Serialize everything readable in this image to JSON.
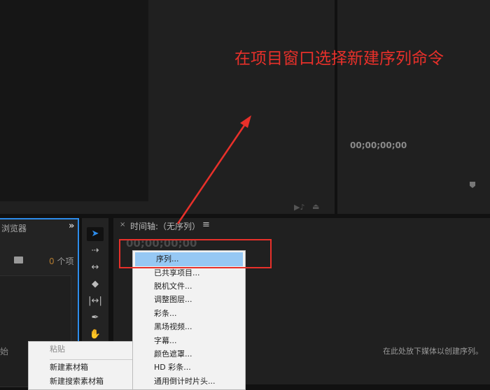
{
  "annotation": "在项目窗口选择新建序列命令",
  "program_monitor": {
    "timecode": "00;00;00;00"
  },
  "project_panel": {
    "title": "浏览器",
    "more": "»",
    "item_count_num": "0",
    "item_count_unit": " 个项",
    "cut_text": "始"
  },
  "tools": [
    "select",
    "track-select",
    "ripple-edit",
    "razor",
    "slip",
    "pen",
    "hand"
  ],
  "timeline": {
    "close": "×",
    "title": "时间轴:（无序列）",
    "menu": "≡",
    "timecode": "00;00;00;00",
    "drop_hint": "在此处放下媒体以创建序列。"
  },
  "context_menu": {
    "items": [
      {
        "label": "粘贴",
        "disabled": true
      },
      {
        "label": "新建素材箱"
      },
      {
        "label": "新建搜索素材箱"
      }
    ]
  },
  "new_item_submenu": {
    "items": [
      "序列...",
      "已共享项目...",
      "脱机文件...",
      "调整图层...",
      "彩条...",
      "黑场视频...",
      "字幕...",
      "颜色遮罩...",
      "HD 彩条...",
      "通用倒计时片头..."
    ]
  },
  "colors": {
    "accent": "#2d8ceb",
    "annotation": "#e8302a",
    "highlight": "#96c8f4"
  }
}
